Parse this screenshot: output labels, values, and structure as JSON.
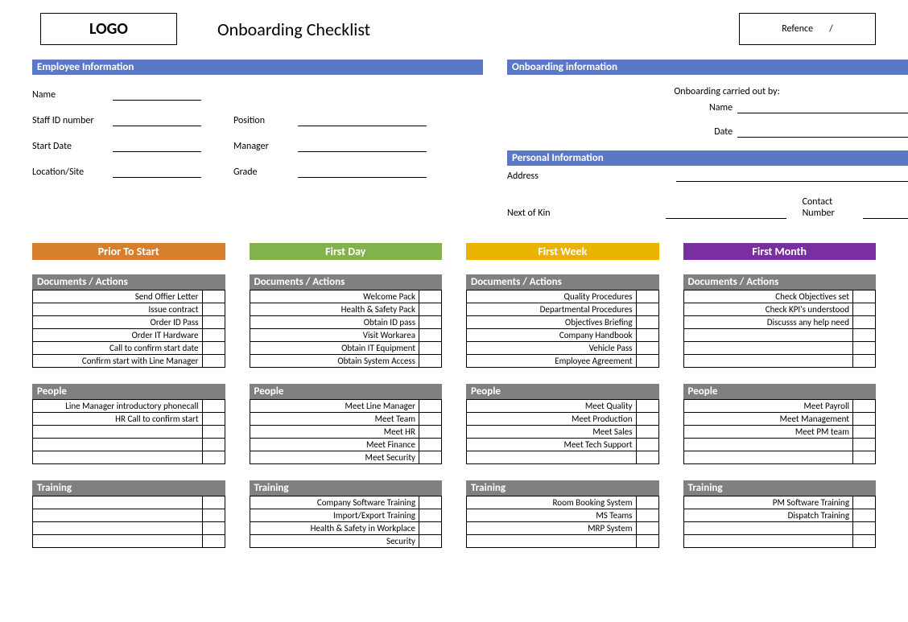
{
  "header": {
    "logo": "LOGO",
    "title": "Onboarding Checklist",
    "ref_label": "Refence",
    "ref_sep": "/"
  },
  "employee_info": {
    "bar": "Employee Information",
    "name": "Name",
    "staff_id": "Staff ID number",
    "position": "Position",
    "start_date": "Start Date",
    "manager": "Manager",
    "location": "Location/Site",
    "grade": "Grade"
  },
  "onboarding_info": {
    "bar": "Onboarding information",
    "carried_out": "Onboarding carried out by:",
    "name": "Name",
    "date": "Date"
  },
  "personal_info": {
    "bar": "Personal Information",
    "address": "Address",
    "next_of_kin": "Next of Kin",
    "contact": "Contact Number"
  },
  "phases": {
    "prior": {
      "label": "Prior To Start",
      "docs_label": "Documents / Actions",
      "docs": [
        "Send Offier Letter",
        "Issue contract",
        "Order ID Pass",
        "Order IT Hardware",
        "Call to confirm start date",
        "Confirm start with Line Manager"
      ],
      "people_label": "People",
      "people": [
        "Line Manager introductory phonecall",
        "HR Call to confirm start",
        "",
        "",
        ""
      ],
      "training_label": "Training",
      "training": [
        "",
        "",
        "",
        ""
      ]
    },
    "first_day": {
      "label": "First Day",
      "docs_label": "Documents / Actions",
      "docs": [
        "Welcome Pack",
        "Health & Safety Pack",
        "Obtain ID pass",
        "Visit Workarea",
        "Obtain IT Equipment",
        "Obtain System Access"
      ],
      "people_label": "People",
      "people": [
        "Meet Line Manager",
        "Meet Team",
        "Meet HR",
        "Meet Finance",
        "Meet Security"
      ],
      "training_label": "Training",
      "training": [
        "Company Software Training",
        "Import/Export Training",
        "Health & Safety in Workplace",
        "Security"
      ]
    },
    "first_week": {
      "label": "First Week",
      "docs_label": "Documents / Actions",
      "docs": [
        "Quality Procedures",
        "Departmental Procedures",
        "Objectives Briefing",
        "Company Handbook",
        "Vehicle Pass",
        "Employee Agreement"
      ],
      "people_label": "People",
      "people": [
        "Meet Quality",
        "Meet Production",
        "Meet Sales",
        "Meet Tech Support",
        ""
      ],
      "training_label": "Training",
      "training": [
        "Room Booking System",
        "MS Teams",
        "MRP System",
        ""
      ]
    },
    "first_month": {
      "label": "First Month",
      "docs_label": "Documents / Actions",
      "docs": [
        "Check Objectives set",
        "Check KPI's understood",
        "Discusss any help need",
        "",
        "",
        ""
      ],
      "people_label": "People",
      "people": [
        "Meet Payroll",
        "Meet Management",
        "Meet PM team",
        "",
        ""
      ],
      "training_label": "Training",
      "training": [
        "PM Software Training",
        "Dispatch Training",
        "",
        ""
      ]
    }
  }
}
